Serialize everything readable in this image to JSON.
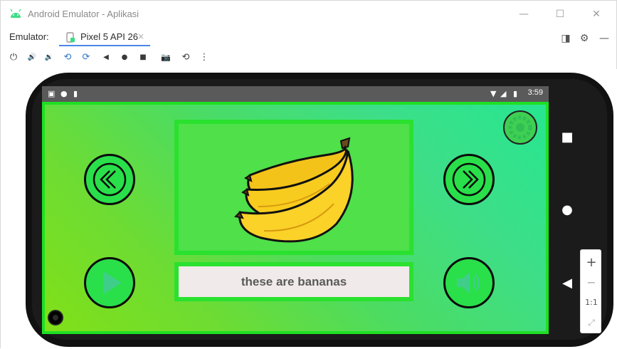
{
  "window": {
    "title": "Android Emulator - Aplikasi",
    "controls": {
      "minimize": "—",
      "maximize": "☐",
      "close": "✕"
    }
  },
  "tabs": {
    "label": "Emulator:",
    "active_tab": "Pixel 5 API 26",
    "close_glyph": "×"
  },
  "tab_actions": {
    "layout_glyph": "◨",
    "settings_glyph": "⚙",
    "hide_glyph": "—"
  },
  "toolbar": {
    "power": "⏻",
    "volume_up": "🔊",
    "volume_down": "🔉",
    "rotate_left": "⟲",
    "rotate_right": "⟳",
    "back": "◀",
    "home": "●",
    "overview": "■",
    "screenshot": "📷",
    "snapshot": "⟲",
    "more": "⋮"
  },
  "status_bar": {
    "time": "3:59"
  },
  "app": {
    "caption": "these are bananas",
    "colors": {
      "accent": "#1ee022",
      "button": "#29e04a",
      "caption_bg": "#f1eaea"
    }
  },
  "nav_bar": {
    "overview": "■",
    "home": "●",
    "back": "◀"
  },
  "zoom": {
    "zoom_in": "+",
    "zoom_out": "−",
    "ratio": "1:1",
    "fit": "⤢"
  }
}
